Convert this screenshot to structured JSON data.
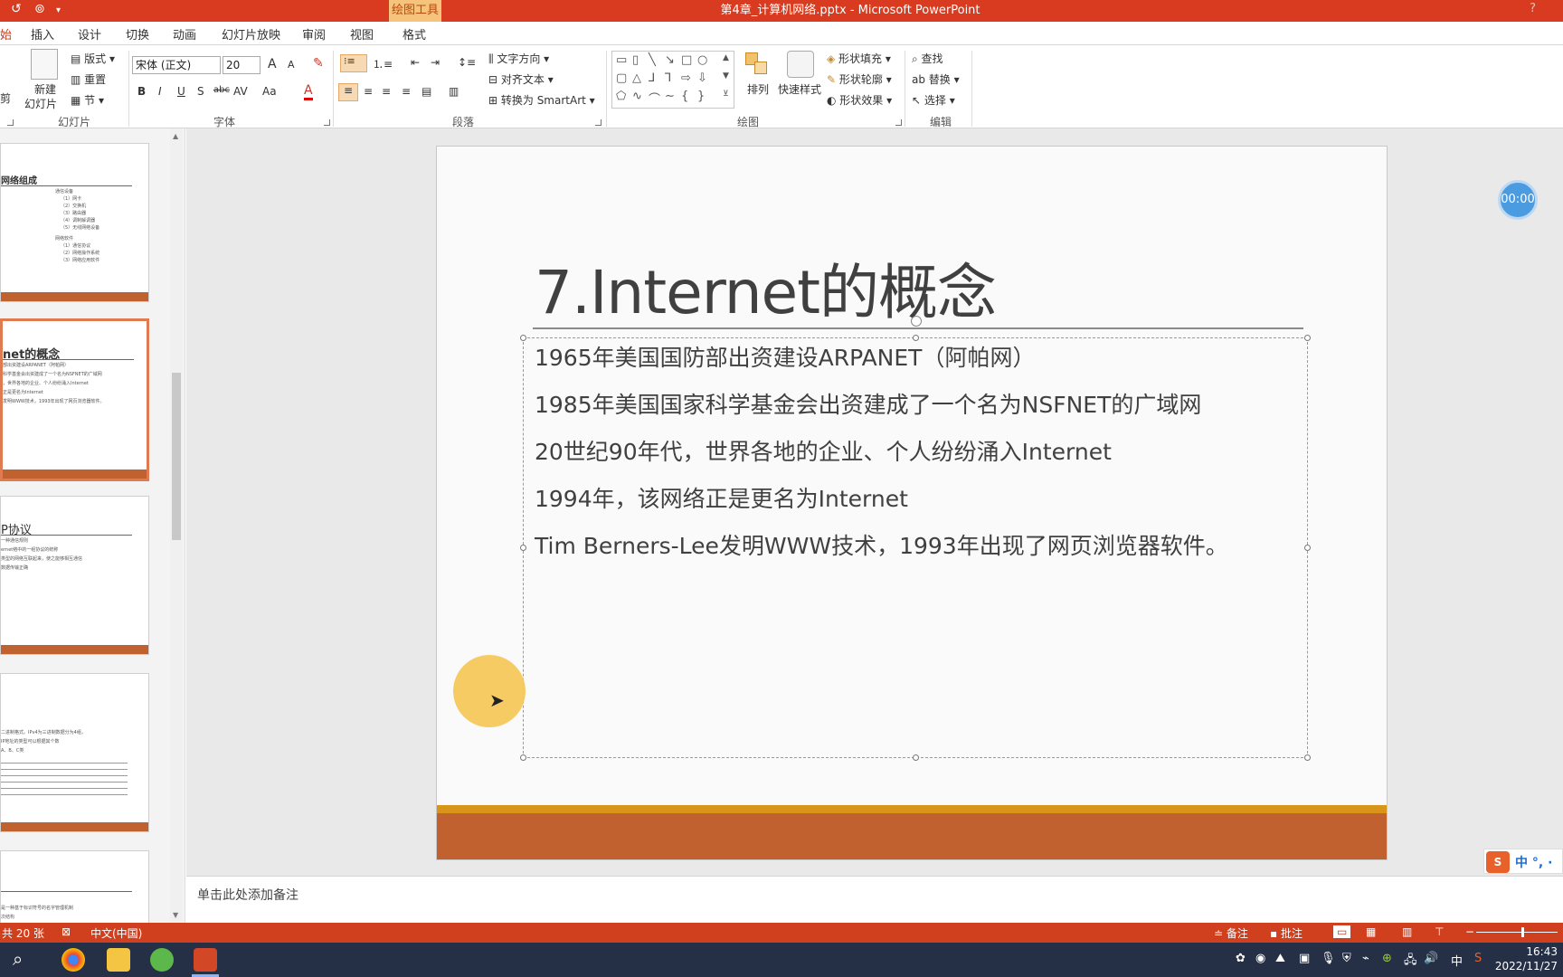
{
  "titlebar": {
    "contextual_tab": "绘图工具",
    "window_title": "第4章_计算机网络.pptx - Microsoft PowerPoint",
    "help": "?"
  },
  "tabs": [
    "插入",
    "设计",
    "切换",
    "动画",
    "幻灯片放映",
    "审阅",
    "视图",
    "格式"
  ],
  "ribbon": {
    "slides": {
      "new_slide": "新建",
      "new_slide2": "幻灯片",
      "layout": "版式",
      "reset": "重置",
      "section": "节",
      "label": "幻灯片"
    },
    "font": {
      "name": "宋体 (正文)",
      "size": "20",
      "label": "字体",
      "bold": "B",
      "italic": "I",
      "underline": "U",
      "shadow": "S",
      "strike": "abc",
      "spacing": "AV",
      "case": "Aa",
      "color": "A",
      "grow": "A",
      "shrink": "A"
    },
    "paragraph": {
      "text_dir": "文字方向",
      "align_text": "对齐文本",
      "smartart": "转换为 SmartArt",
      "label": "段落"
    },
    "drawing": {
      "arrange": "排列",
      "quick_styles": "快速样式",
      "fill": "形状填充",
      "outline": "形状轮廓",
      "effects": "形状效果",
      "label": "绘图"
    },
    "editing": {
      "find": "查找",
      "replace": "替换",
      "select": "选择",
      "label": "编辑"
    }
  },
  "thumbnails": [
    {
      "title": "网络组成",
      "lines": [
        "通信设备",
        "（1）网卡",
        "（2）交换机",
        "（3）路由器",
        "（4）调制解调器",
        "（5）无线网络设备",
        "网络软件",
        "（1）通信协议",
        "（2）网络操作系统",
        "（3）网络应用软件"
      ]
    },
    {
      "title": "net的概念",
      "lines": [
        "部出资建设ARPANET（阿帕网）",
        "科学基金会出资建成了一个名为NSFNET的广域网",
        "，世界各地的企业、个人纷纷涌入Internet",
        "正是更名为Internet",
        "发明WWW技术，1993年出现了网页浏览器软件。"
      ]
    },
    {
      "title": "P协议",
      "lines": [
        "一种通信规则",
        "ernet络中的一组协议的统称",
        "类型的网络互联起来，使之能够相互通信",
        "数据传输正确"
      ]
    },
    {
      "title": "",
      "lines": [
        "二进制格式。IPv4为三进制数据分为4组，",
        "IP地址的类型可以根据其个数",
        "A、B、C类"
      ]
    },
    {
      "title": "",
      "lines": [
        "是一种基于标识符号的名字管理机制",
        "次结构"
      ]
    }
  ],
  "slide": {
    "title": "7.Internet的概念",
    "bullets": [
      "1965年美国国防部出资建设ARPANET（阿帕网）",
      "1985年美国国家科学基金会出资建成了一个名为NSFNET的广域网",
      "20世纪90年代，世界各地的企业、个人纷纷涌入Internet",
      "1994年，该网络正是更名为Internet",
      "Tim Berners-Lee发明WWW技术，1993年出现了网页浏览器软件。"
    ]
  },
  "timer": "00:00",
  "notes_placeholder": "单击此处添加备注",
  "ime": {
    "logo": "S",
    "text": "中 °, ·"
  },
  "status": {
    "slide_count": "共 20 张",
    "language": "中文(中国)",
    "notes": "备注",
    "comments": "批注"
  },
  "clock": {
    "time": "16:43",
    "date": "2022/11/27"
  },
  "tray_lang": "中"
}
